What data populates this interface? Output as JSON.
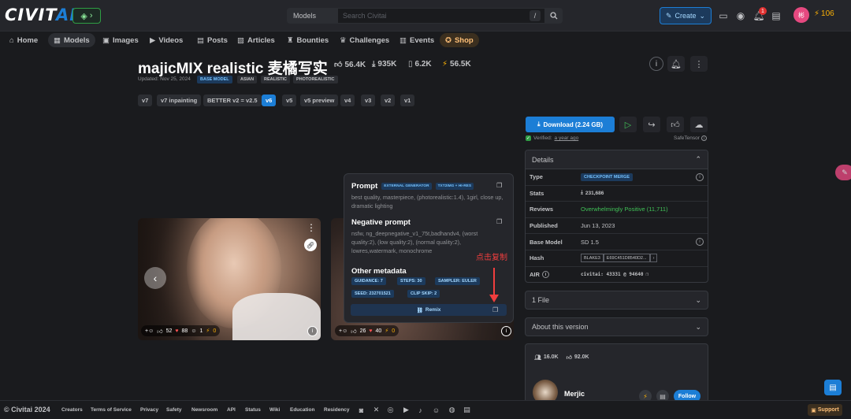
{
  "header": {
    "logo_main": "CIVIT",
    "logo_accent": "AI",
    "search_category": "Models",
    "search_placeholder": "Search Civitai",
    "search_shortcut": "/",
    "create_label": "Create",
    "notification_count": "1",
    "avatar_initials": "彬",
    "buzz_amount": "106"
  },
  "nav": [
    {
      "label": "Home",
      "icon": "home-icon"
    },
    {
      "label": "Models",
      "icon": "models-icon"
    },
    {
      "label": "Images",
      "icon": "images-icon"
    },
    {
      "label": "Videos",
      "icon": "videos-icon"
    },
    {
      "label": "Posts",
      "icon": "posts-icon"
    },
    {
      "label": "Articles",
      "icon": "articles-icon"
    },
    {
      "label": "Bounties",
      "icon": "bounties-icon"
    },
    {
      "label": "Challenges",
      "icon": "challenges-icon"
    },
    {
      "label": "Events",
      "icon": "events-icon"
    },
    {
      "label": "Shop",
      "icon": "shop-icon"
    }
  ],
  "model": {
    "title": "majicMIX realistic 麦橘写实",
    "likes": "56.4K",
    "downloads": "935K",
    "bookmarks": "6.2K",
    "buzz": "56.5K",
    "updated": "Updated: Nov 25, 2024",
    "tags": [
      "BASE MODEL",
      "ASIAN",
      "REALISTIC",
      "PHOTOREALISTIC"
    ]
  },
  "versions": [
    "v7",
    "v7 inpainting",
    "BETTER v2 = v2.5",
    "v6",
    "v5",
    "v5 preview",
    "v4",
    "v3",
    "v2",
    "v1"
  ],
  "images": [
    {
      "likes": "52",
      "hearts": "88",
      "laughs": "1",
      "buzz": "0"
    },
    {
      "likes": "26",
      "hearts": "40",
      "buzz": "0"
    }
  ],
  "prompt_panel": {
    "prompt_title": "Prompt",
    "badge_generator": "EXTERNAL GENERATOR",
    "badge_mode": "TXT2IMG + HI-RES",
    "prompt_text": "best quality, masterpiece, (photorealistic:1.4), 1girl, close up, dramatic lighting",
    "negative_title": "Negative prompt",
    "negative_text": "nsfw, ng_deepnegative_v1_75t,badhandv4, (worst quality:2), (low quality:2), (normal quality:2), lowres,watermark, monochrome",
    "other_title": "Other metadata",
    "meta": [
      "GUIDANCE: 7",
      "STEPS: 30",
      "SAMPLER: EULER",
      "SEED: 232701521",
      "CLIP SKIP: 2"
    ],
    "remix_label": "Remix",
    "annotation": "点击复制"
  },
  "download": {
    "label": "Download (2.24 GB)",
    "verified_prefix": "Verified:",
    "verified_time": "a year ago",
    "format": "SafeTensor"
  },
  "details": {
    "heading": "Details",
    "rows": [
      {
        "label": "Type",
        "value": "CHECKPOINT MERGE"
      },
      {
        "label": "Stats",
        "value": "231,686"
      },
      {
        "label": "Reviews",
        "value": "Overwhelmingly Positive (11,711)"
      },
      {
        "label": "Published",
        "value": "Jun 13, 2023"
      },
      {
        "label": "Base Model",
        "value": "SD 1.5"
      },
      {
        "label": "Hash",
        "algo": "BLAKE3",
        "value": "E69C451D8540D2..."
      },
      {
        "label": "AIR",
        "value": "civitai: 43331 @ 94640"
      }
    ]
  },
  "files_label": "1 File",
  "about_label": "About this version",
  "creator": {
    "followers": "16.0K",
    "likes": "92.0K",
    "name": "Merjic",
    "follow_label": "Follow"
  },
  "footer": {
    "copyright": "© Civitai 2024",
    "links": [
      "Creators",
      "Terms of Service",
      "Privacy",
      "Safety",
      "Newsroom",
      "API",
      "Status",
      "Wiki",
      "Education",
      "Residency"
    ],
    "support_label": "Support"
  },
  "colors": {
    "accent": "#1c7ed6",
    "background": "#1a1b1e",
    "surface": "#25262b",
    "success": "#40c057",
    "buzz": "#fab005",
    "annotation": "#f03e3e"
  }
}
